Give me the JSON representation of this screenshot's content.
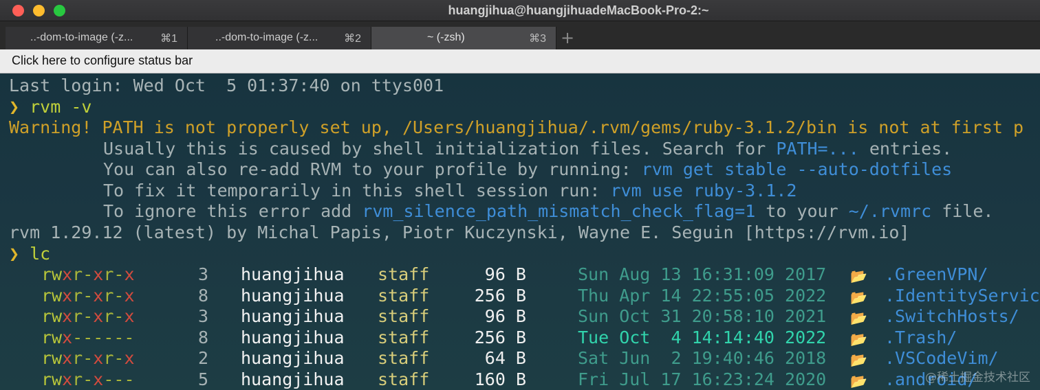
{
  "window": {
    "title": "huangjihua@huangjihuadeMacBook-Pro-2:~"
  },
  "tabs": [
    {
      "label": "..-dom-to-image (-z...",
      "shortcut": "⌘1",
      "active": false
    },
    {
      "label": "..-dom-to-image (-z...",
      "shortcut": "⌘2",
      "active": false
    },
    {
      "label": "~ (-zsh)",
      "shortcut": "⌘3",
      "active": true
    }
  ],
  "new_tab_label": "+",
  "status_bar": {
    "label": "Click here to configure status bar"
  },
  "terminal": {
    "last_login": "Last login: Wed Oct  5 01:37:40 on ttys001",
    "prompt_symbol": "❯",
    "cmd1": "rvm -v",
    "warning_line": "Warning! PATH is not properly set up, /Users/huangjihua/.rvm/gems/ruby-3.1.2/bin is not at first p",
    "hint1_pre": "Usually this is caused by shell initialization files. Search for ",
    "hint1_code": "PATH=...",
    "hint1_post": " entries.",
    "hint2_pre": "You can also re-add RVM to your profile by running: ",
    "hint2_code": "rvm get stable --auto-dotfiles",
    "hint3_pre": "To fix it temporarily in this shell session run: ",
    "hint3_code": "rvm use ruby-3.1.2",
    "hint4_pre": "To ignore this error add ",
    "hint4_code": "rvm_silence_path_mismatch_check_flag=1",
    "hint4_mid": " to your ",
    "hint4_code2": "~/.rvmrc",
    "hint4_post": " file.",
    "version_line": "rvm 1.29.12 (latest) by Michal Papis, Piotr Kuczynski, Wayne E. Seguin [https://rvm.io]",
    "cmd2": "lc",
    "folder_icon": "📂",
    "listing": [
      {
        "perm": [
          "rw",
          "x",
          "r-",
          "x",
          "r-",
          "x"
        ],
        "links": "3",
        "owner": "huangjihua",
        "group": "staff",
        "size": "96 B",
        "date": "Sun Aug 13 16:31:09 2017",
        "recent": false,
        "name": ".GreenVPN/"
      },
      {
        "perm": [
          "rw",
          "x",
          "r-",
          "x",
          "r-",
          "x"
        ],
        "links": "8",
        "owner": "huangjihua",
        "group": "staff",
        "size": "256 B",
        "date": "Thu Apr 14 22:55:05 2022",
        "recent": false,
        "name": ".IdentityServic"
      },
      {
        "perm": [
          "rw",
          "x",
          "r-",
          "x",
          "r-",
          "x"
        ],
        "links": "3",
        "owner": "huangjihua",
        "group": "staff",
        "size": "96 B",
        "date": "Sun Oct 31 20:58:10 2021",
        "recent": false,
        "name": ".SwitchHosts/"
      },
      {
        "perm": [
          "rw",
          "x",
          "------",
          "",
          "",
          ""
        ],
        "links": "8",
        "owner": "huangjihua",
        "group": "staff",
        "size": "256 B",
        "date": "Tue Oct  4 14:14:40 2022",
        "recent": true,
        "name": ".Trash/"
      },
      {
        "perm": [
          "rw",
          "x",
          "r-",
          "x",
          "r-",
          "x"
        ],
        "links": "2",
        "owner": "huangjihua",
        "group": "staff",
        "size": "64 B",
        "date": "Sat Jun  2 19:40:46 2018",
        "recent": false,
        "name": ".VSCodeVim/"
      },
      {
        "perm": [
          "rw",
          "x",
          "r-",
          "x",
          "---",
          ""
        ],
        "links": "5",
        "owner": "huangjihua",
        "group": "staff",
        "size": "160 B",
        "date": "Fri Jul 17 16:23:24 2020",
        "recent": false,
        "name": ".android/"
      }
    ]
  },
  "watermark": "@稀土掘金技术社区"
}
